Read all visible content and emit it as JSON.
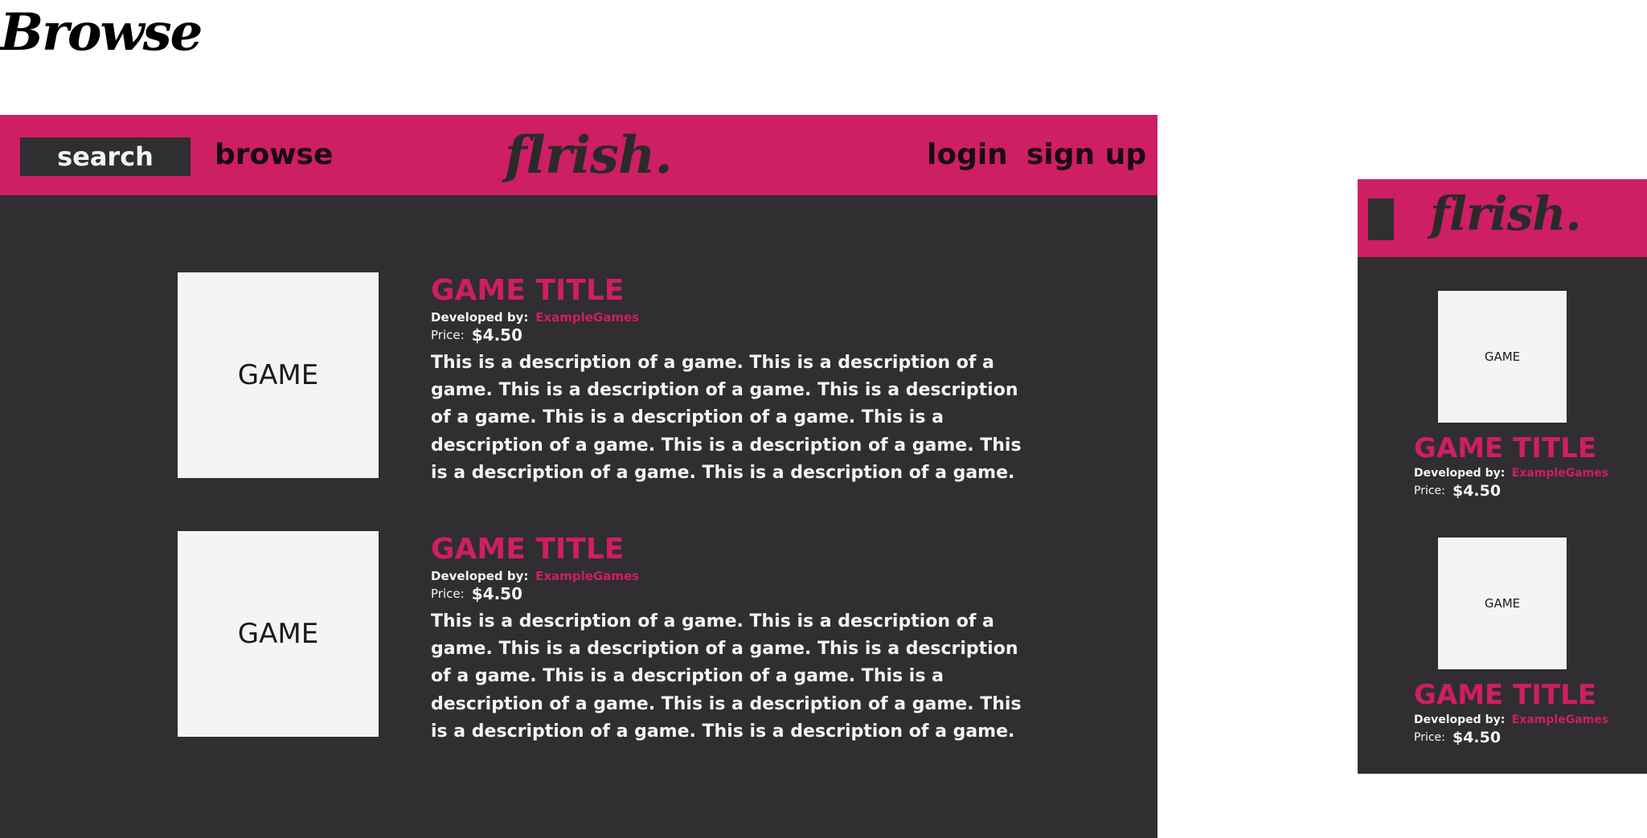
{
  "page": {
    "heading": "Browse"
  },
  "colors": {
    "accent": "#ce1e64",
    "background_dark": "#302e30",
    "thumb": "#f4f4f4",
    "text_light": "#f4f4f4"
  },
  "desktop": {
    "nav": {
      "search_label": "search",
      "browse_label": "browse",
      "logo": "flrish.",
      "login_label": "login",
      "signup_label": "sign up"
    },
    "games": [
      {
        "thumb_label": "GAME",
        "title": "GAME TITLE",
        "developed_by_label": "Developed by:",
        "developer": "ExampleGames",
        "price_label": "Price:",
        "price": "$4.50",
        "description": "This is a description of a game. This is a description of a game. This is a description of a game. This is a description of a game. This is a description of a game. This is a description of a game. This is a description of a game. This is a description of a game. This is a description of a game."
      },
      {
        "thumb_label": "GAME",
        "title": "GAME TITLE",
        "developed_by_label": "Developed by:",
        "developer": "ExampleGames",
        "price_label": "Price:",
        "price": "$4.50",
        "description": "This is a description of a game. This is a description of a game. This is a description of a game. This is a description of a game. This is a description of a game. This is a description of a game. This is a description of a game. This is a description of a game. This is a description of a game."
      }
    ]
  },
  "mobile": {
    "header": {
      "menu_icon": "menu-icon",
      "logo": "flrish."
    },
    "games": [
      {
        "thumb_label": "GAME",
        "title": "GAME TITLE",
        "developed_by_label": "Developed by:",
        "developer": "ExampleGames",
        "price_label": "Price:",
        "price": "$4.50"
      },
      {
        "thumb_label": "GAME",
        "title": "GAME TITLE",
        "developed_by_label": "Developed by:",
        "developer": "ExampleGames",
        "price_label": "Price:",
        "price": "$4.50"
      }
    ]
  }
}
